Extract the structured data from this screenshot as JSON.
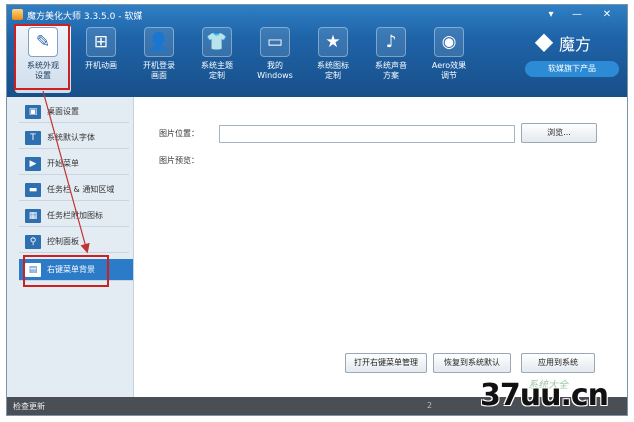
{
  "window": {
    "title": "魔方美化大师 3.3.5.0 - 软媒",
    "controls": [
      "▾",
      "—",
      "✕"
    ]
  },
  "toolbar": {
    "items": [
      {
        "label_1": "系统外观",
        "label_2": "设置",
        "icon": "brush-icon",
        "glyph": "✎"
      },
      {
        "label_1": "开机动画",
        "label_2": "",
        "icon": "windows-logo-icon",
        "glyph": "⊞"
      },
      {
        "label_1": "开机登录",
        "label_2": "画面",
        "icon": "user-login-icon",
        "glyph": "👤"
      },
      {
        "label_1": "系统主题",
        "label_2": "定制",
        "icon": "shirt-icon",
        "glyph": "👕"
      },
      {
        "label_1": "我的",
        "label_2": "Windows",
        "icon": "oem-icon",
        "glyph": "▭"
      },
      {
        "label_1": "系统图标",
        "label_2": "定制",
        "icon": "star-icon",
        "glyph": "★"
      },
      {
        "label_1": "系统声音",
        "label_2": "方案",
        "icon": "music-note-icon",
        "glyph": "♪"
      },
      {
        "label_1": "Aero效果",
        "label_2": "调节",
        "icon": "aero-disc-icon",
        "glyph": "◉"
      }
    ]
  },
  "brand": {
    "name": "魔方",
    "slogan": "软媒旗下产品",
    "cube_glyph": "◆"
  },
  "sidebar": {
    "items": [
      {
        "label": "桌面设置",
        "glyph": "▣"
      },
      {
        "label": "系统默认字体",
        "glyph": "T"
      },
      {
        "label": "开始菜单",
        "glyph": "▶"
      },
      {
        "label": "任务栏 & 通知区域",
        "glyph": "▬"
      },
      {
        "label": "任务栏附加图标",
        "glyph": "▦"
      },
      {
        "label": "控制面板",
        "glyph": "⚲"
      },
      {
        "label": "右键菜单背景",
        "glyph": "▤"
      }
    ],
    "selected_index": 6
  },
  "main": {
    "image_path_label": "图片位置：",
    "image_path_value": "",
    "browse_label": "浏览...",
    "preview_label": "图片预览：",
    "open_manager_label": "打开右键菜单管理",
    "restore_default_label": "恢复到系统默认",
    "apply_label": "应用到系统"
  },
  "status": {
    "check_update": "检查更新",
    "right_text": "2"
  },
  "watermark": {
    "text": "37uu.cn",
    "faint": "系统大全"
  },
  "colors": {
    "titlebar": "#1f64a8",
    "selected_sidebar": "#2c7bc8",
    "annotation_red": "#d01f1f"
  }
}
